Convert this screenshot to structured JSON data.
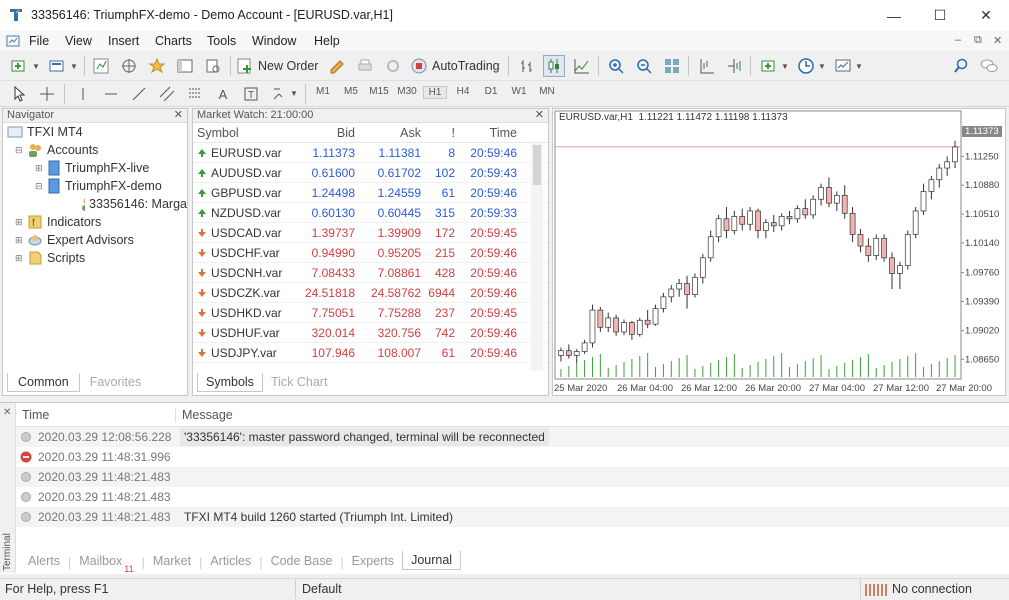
{
  "window": {
    "title": "33356146: TriumphFX-demo - Demo Account - [EURUSD.var,H1]",
    "minimize": "—",
    "maximize": "☐",
    "close": "✕"
  },
  "menu": [
    "File",
    "View",
    "Insert",
    "Charts",
    "Tools",
    "Window",
    "Help"
  ],
  "toolbar": {
    "new_order": "New Order",
    "autotrading": "AutoTrading"
  },
  "timeframes": [
    "M1",
    "M5",
    "M15",
    "M30",
    "H1",
    "H4",
    "D1",
    "W1",
    "MN"
  ],
  "active_timeframe": "H1",
  "navigator": {
    "title": "Navigator",
    "root": "TFXI MT4",
    "accounts": "Accounts",
    "live": "TriumphFX-live",
    "demo": "TriumphFX-demo",
    "account": "33356146: Marga",
    "indicators": "Indicators",
    "experts": "Expert Advisors",
    "scripts": "Scripts",
    "tabs": [
      "Common",
      "Favorites"
    ]
  },
  "market_watch": {
    "title": "Market Watch: 21:00:00",
    "columns": [
      "Symbol",
      "Bid",
      "Ask",
      "!",
      "Time"
    ],
    "rows": [
      {
        "symbol": "EURUSD.var",
        "bid": "1.11373",
        "ask": "1.11381",
        "spread": "8",
        "time": "20:59:46",
        "dir": "up"
      },
      {
        "symbol": "AUDUSD.var",
        "bid": "0.61600",
        "ask": "0.61702",
        "spread": "102",
        "time": "20:59:43",
        "dir": "up"
      },
      {
        "symbol": "GBPUSD.var",
        "bid": "1.24498",
        "ask": "1.24559",
        "spread": "61",
        "time": "20:59:46",
        "dir": "up"
      },
      {
        "symbol": "NZDUSD.var",
        "bid": "0.60130",
        "ask": "0.60445",
        "spread": "315",
        "time": "20:59:33",
        "dir": "up"
      },
      {
        "symbol": "USDCAD.var",
        "bid": "1.39737",
        "ask": "1.39909",
        "spread": "172",
        "time": "20:59:45",
        "dir": "down"
      },
      {
        "symbol": "USDCHF.var",
        "bid": "0.94990",
        "ask": "0.95205",
        "spread": "215",
        "time": "20:59:46",
        "dir": "down"
      },
      {
        "symbol": "USDCNH.var",
        "bid": "7.08433",
        "ask": "7.08861",
        "spread": "428",
        "time": "20:59:46",
        "dir": "down"
      },
      {
        "symbol": "USDCZK.var",
        "bid": "24.51818",
        "ask": "24.58762",
        "spread": "6944",
        "time": "20:59:46",
        "dir": "down"
      },
      {
        "symbol": "USDHKD.var",
        "bid": "7.75051",
        "ask": "7.75288",
        "spread": "237",
        "time": "20:59:45",
        "dir": "down"
      },
      {
        "symbol": "USDHUF.var",
        "bid": "320.014",
        "ask": "320.756",
        "spread": "742",
        "time": "20:59:46",
        "dir": "down"
      },
      {
        "symbol": "USDJPY.var",
        "bid": "107.946",
        "ask": "108.007",
        "spread": "61",
        "time": "20:59:46",
        "dir": "down"
      }
    ],
    "tabs": [
      "Symbols",
      "Tick Chart"
    ]
  },
  "chart": {
    "info": "EURUSD.var,H1  1.11221 1.11472 1.11198 1.11373",
    "price_label": "1.11373",
    "y_ticks": [
      "1.11250",
      "1.10880",
      "1.10510",
      "1.10140",
      "1.09760",
      "1.09390",
      "1.09020",
      "1.08650"
    ],
    "x_ticks": [
      "25 Mar 2020",
      "26 Mar 04:00",
      "26 Mar 12:00",
      "26 Mar 20:00",
      "27 Mar 04:00",
      "27 Mar 12:00",
      "27 Mar 20:00"
    ]
  },
  "chart_data": {
    "type": "candlestick",
    "ylim": [
      1.085,
      1.116
    ],
    "bull_color": "#ffffff",
    "bear_color": "#f4b4b4",
    "candles": [
      [
        1.087,
        1.088,
        1.0862,
        1.0876
      ],
      [
        1.0876,
        1.0884,
        1.0866,
        1.087
      ],
      [
        1.087,
        1.0878,
        1.086,
        1.0875
      ],
      [
        1.0875,
        1.089,
        1.0872,
        1.0886
      ],
      [
        1.0886,
        1.0935,
        1.088,
        1.0928
      ],
      [
        1.0928,
        1.0932,
        1.09,
        1.0906
      ],
      [
        1.0906,
        1.0925,
        1.09,
        1.0918
      ],
      [
        1.0918,
        1.0922,
        1.0895,
        1.09
      ],
      [
        1.09,
        1.0916,
        1.0896,
        1.0912
      ],
      [
        1.0912,
        1.0914,
        1.089,
        1.0897
      ],
      [
        1.0897,
        1.0918,
        1.0894,
        1.0915
      ],
      [
        1.0915,
        1.0928,
        1.0905,
        1.091
      ],
      [
        1.091,
        1.0935,
        1.0908,
        1.093
      ],
      [
        1.093,
        1.095,
        1.0925,
        1.0945
      ],
      [
        1.0945,
        1.096,
        1.0938,
        1.0955
      ],
      [
        1.0955,
        1.0968,
        1.0945,
        1.0962
      ],
      [
        1.0962,
        1.0972,
        1.093,
        1.0948
      ],
      [
        1.0948,
        1.0975,
        1.0944,
        1.097
      ],
      [
        1.097,
        1.1,
        1.0962,
        1.0995
      ],
      [
        1.0995,
        1.103,
        1.099,
        1.1022
      ],
      [
        1.1022,
        1.105,
        1.1015,
        1.1045
      ],
      [
        1.1045,
        1.106,
        1.102,
        1.103
      ],
      [
        1.103,
        1.1055,
        1.1025,
        1.1048
      ],
      [
        1.1048,
        1.1058,
        1.103,
        1.1038
      ],
      [
        1.1038,
        1.106,
        1.103,
        1.1055
      ],
      [
        1.1055,
        1.1058,
        1.102,
        1.103
      ],
      [
        1.103,
        1.1045,
        1.102,
        1.104
      ],
      [
        1.104,
        1.105,
        1.1028,
        1.1036
      ],
      [
        1.1036,
        1.1052,
        1.103,
        1.1048
      ],
      [
        1.1048,
        1.1055,
        1.1038,
        1.1045
      ],
      [
        1.1045,
        1.1062,
        1.104,
        1.1058
      ],
      [
        1.1058,
        1.107,
        1.1045,
        1.105
      ],
      [
        1.105,
        1.1075,
        1.1045,
        1.107
      ],
      [
        1.107,
        1.109,
        1.1062,
        1.1085
      ],
      [
        1.1085,
        1.1098,
        1.106,
        1.1065
      ],
      [
        1.1065,
        1.108,
        1.1055,
        1.1075
      ],
      [
        1.1075,
        1.1088,
        1.1045,
        1.1052
      ],
      [
        1.1052,
        1.106,
        1.1015,
        1.1025
      ],
      [
        1.1025,
        1.1032,
        1.1002,
        1.101
      ],
      [
        1.101,
        1.102,
        1.099,
        1.0998
      ],
      [
        1.0998,
        1.1025,
        1.0992,
        1.102
      ],
      [
        1.102,
        1.1025,
        1.099,
        1.0995
      ],
      [
        1.0995,
        1.1002,
        1.0955,
        1.0975
      ],
      [
        1.0975,
        1.099,
        1.0955,
        1.0985
      ],
      [
        1.0985,
        1.103,
        1.098,
        1.1025
      ],
      [
        1.1025,
        1.106,
        1.102,
        1.1055
      ],
      [
        1.1055,
        1.109,
        1.105,
        1.108
      ],
      [
        1.108,
        1.11,
        1.107,
        1.1095
      ],
      [
        1.1095,
        1.1115,
        1.1085,
        1.111
      ],
      [
        1.111,
        1.1125,
        1.11,
        1.1118
      ],
      [
        1.1118,
        1.1145,
        1.111,
        1.1137
      ]
    ]
  },
  "terminal": {
    "side_label": "Terminal",
    "columns": [
      "Time",
      "Message"
    ],
    "rows": [
      {
        "time": "2020.03.29 12:08:56.228",
        "message": "'33356146': master password changed, terminal will be reconnected",
        "type": "info"
      },
      {
        "time": "2020.03.29 11:48:31.996",
        "message": "",
        "type": "error"
      },
      {
        "time": "2020.03.29 11:48:21.483",
        "message": "",
        "type": "info"
      },
      {
        "time": "2020.03.29 11:48:21.483",
        "message": "",
        "type": "info"
      },
      {
        "time": "2020.03.29 11:48:21.483",
        "message": "TFXI MT4 build 1260 started (Triumph Int. Limited)",
        "type": "info"
      }
    ],
    "tabs": [
      "Alerts",
      "Mailbox",
      "Market",
      "Articles",
      "Code Base",
      "Experts",
      "Journal"
    ],
    "mailbox_count": "11",
    "active_tab": "Journal"
  },
  "status": {
    "help": "For Help, press F1",
    "profile": "Default",
    "connection": "No connection"
  }
}
